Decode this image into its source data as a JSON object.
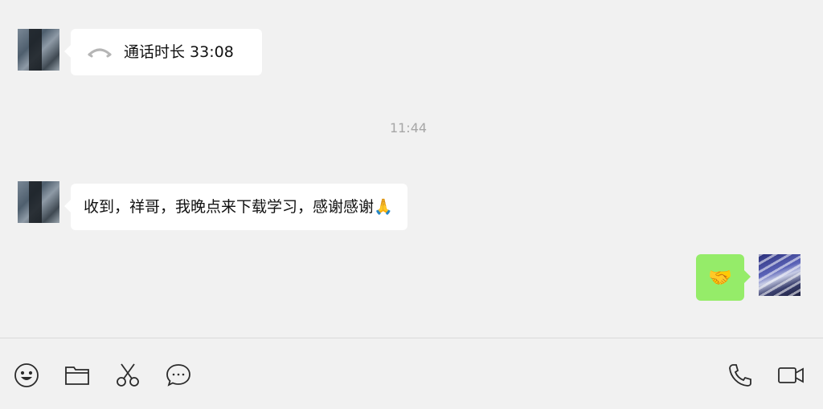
{
  "messages": [
    {
      "from": "peer",
      "type": "call",
      "icon": "phone-hangup-icon",
      "text": "通话时长 33:08"
    },
    {
      "type": "timestamp",
      "text": "11:44"
    },
    {
      "from": "peer",
      "type": "text",
      "text": "收到，祥哥，我晚点来下载学习，感谢感谢🙏"
    },
    {
      "from": "self",
      "type": "text",
      "text": "🤝"
    }
  ],
  "toolbar": {
    "left": [
      "emoji-icon",
      "folder-icon",
      "scissors-icon",
      "chat-bubble-icon"
    ],
    "right": [
      "phone-icon",
      "video-camera-icon"
    ]
  },
  "colors": {
    "background": "#f1f1f1",
    "peer_bubble": "#ffffff",
    "self_bubble": "#95ec69",
    "timestamp": "#a6a6a6"
  }
}
